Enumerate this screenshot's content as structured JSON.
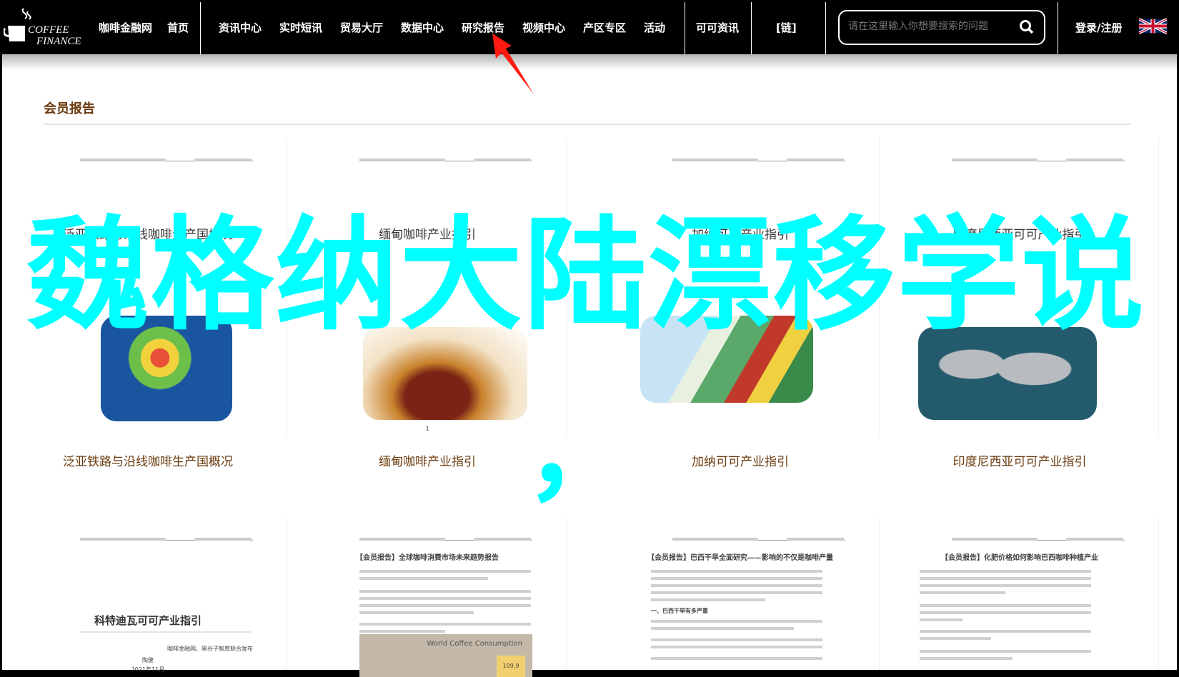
{
  "nav": {
    "logo_text": "COFFEE FINANCE",
    "site_name": "咖啡金融网",
    "home": "首页",
    "items": [
      "资讯中心",
      "实时短讯",
      "贸易大厅",
      "数据中心",
      "研究报告",
      "视频中心",
      "产区专区",
      "活动"
    ],
    "cocoa": "可可资讯",
    "links": "[链]",
    "search_placeholder": "请在这里输入你想要搜索的问题",
    "login": "登录/注册",
    "language_icon": "uk-flag-icon"
  },
  "section": {
    "title": "会员报告"
  },
  "cards": [
    {
      "title": "泛亚铁路与沿线咖啡生产国概况",
      "doc_title": "泛亚铁路与沿线咖啡生产国概况",
      "image": "southeast-asia-map"
    },
    {
      "title": "缅甸咖啡产业指引",
      "doc_title": "缅甸咖啡产业指引",
      "image": "coffee-beans",
      "page_no": "1"
    },
    {
      "title": "加纳可可产业指引",
      "doc_title": "加纳可可产业指引",
      "image": "west-africa-flags-map"
    },
    {
      "title": "印度尼西亚可可产业指引",
      "doc_title": "印度尼西亚可可产业指引",
      "image": "world-map"
    }
  ],
  "cards_row2": [
    {
      "doc_title": "科特迪瓦可可产业指引",
      "publisher": "咖啡金融网、黑谷子智库联合发布",
      "author": "陶健",
      "date": "2021年11月"
    },
    {
      "doc_title": "【会员报告】全球咖啡消费市场未来趋势报告",
      "chart_title": "World Coffee Consumption",
      "chart_value": "109,9"
    },
    {
      "doc_title": "【会员报告】巴西干旱全面研究——影响的不仅是咖啡产量",
      "subheading": "一、巴西干旱有多严重"
    },
    {
      "doc_title": "【会员报告】化肥价格如何影响巴西咖啡种植产业"
    }
  ],
  "overlay": {
    "text": "魏格纳大陆漂移学说",
    "comma": "，",
    "color": "#00ffff"
  },
  "colors": {
    "accent_brown": "#6b3a0e",
    "arrow": "#ff1a10"
  }
}
